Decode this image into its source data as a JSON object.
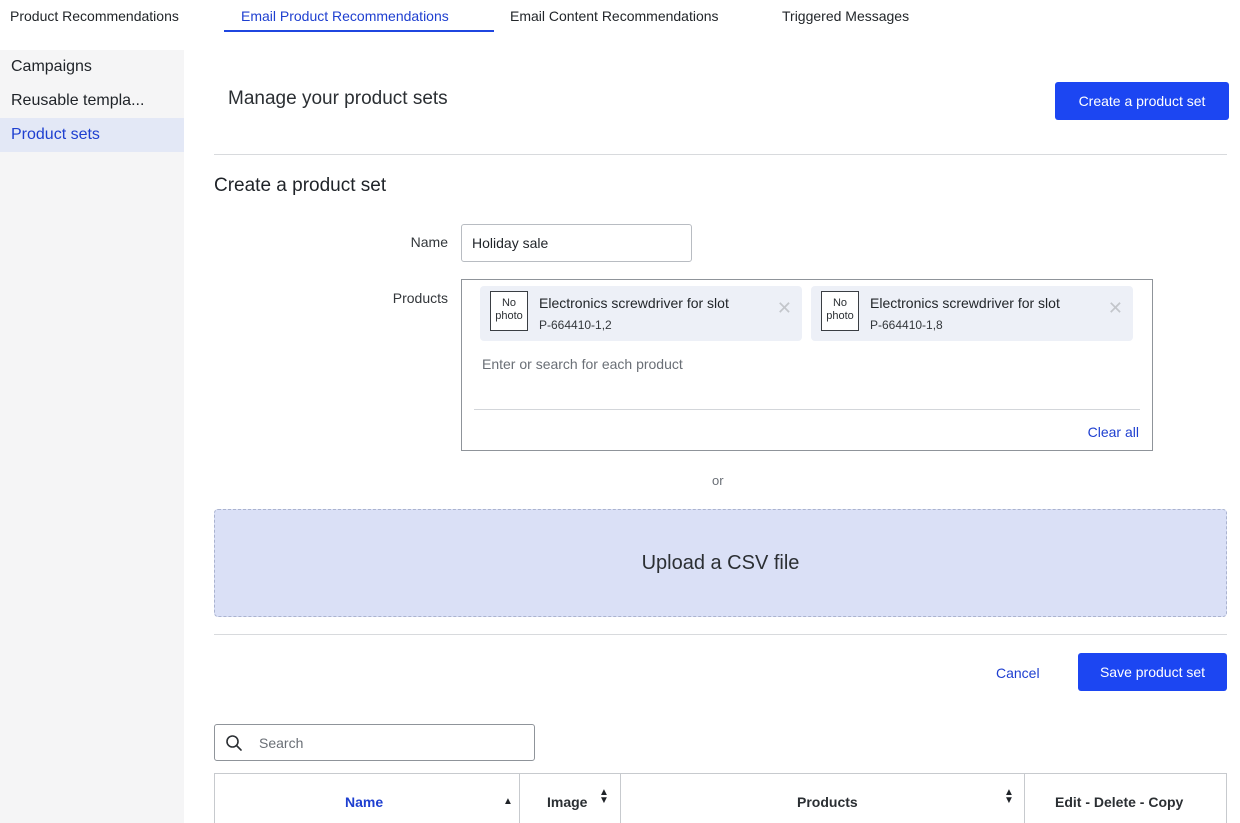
{
  "top_tabs": [
    {
      "label": "Product Recommendations"
    },
    {
      "label": "Email Product Recommendations",
      "active": true
    },
    {
      "label": "Email Content Recommendations"
    },
    {
      "label": "Triggered Messages"
    }
  ],
  "sidebar": {
    "items": [
      {
        "label": "Campaigns"
      },
      {
        "label": "Reusable templa..."
      },
      {
        "label": "Product sets",
        "active": true
      }
    ]
  },
  "header": {
    "title": "Manage your product sets",
    "create_button": "Create a product set"
  },
  "form": {
    "title": "Create a product set",
    "name_label": "Name",
    "name_value": "Holiday sale",
    "products_label": "Products",
    "products": [
      {
        "photo_text": "No photo",
        "name": "Electronics screwdriver for slot",
        "sku": "P-664410-1,2"
      },
      {
        "photo_text": "No photo",
        "name": "Electronics screwdriver for slot",
        "sku": "P-664410-1,8"
      }
    ],
    "product_search_placeholder": "Enter or search for each product",
    "clear_all": "Clear all",
    "or_text": "or",
    "upload_label": "Upload a CSV file",
    "cancel": "Cancel",
    "save": "Save product set"
  },
  "table": {
    "search_placeholder": "Search",
    "columns": [
      {
        "label": "Name",
        "sort": "asc"
      },
      {
        "label": "Image",
        "sort": "both"
      },
      {
        "label": "Products",
        "sort": "both"
      },
      {
        "label": "Edit - Delete - Copy"
      }
    ]
  },
  "colors": {
    "accent": "#1c46f2",
    "link": "#1e3fd0",
    "upload_bg": "#dae0f6",
    "sidebar_bg": "#f5f5f6",
    "sidebar_active_bg": "#e3e8f6"
  },
  "icons": {
    "search": "search-icon",
    "close": "close-icon",
    "sort_up": "sort-up-icon",
    "sort_both": "sort-both-icon"
  }
}
